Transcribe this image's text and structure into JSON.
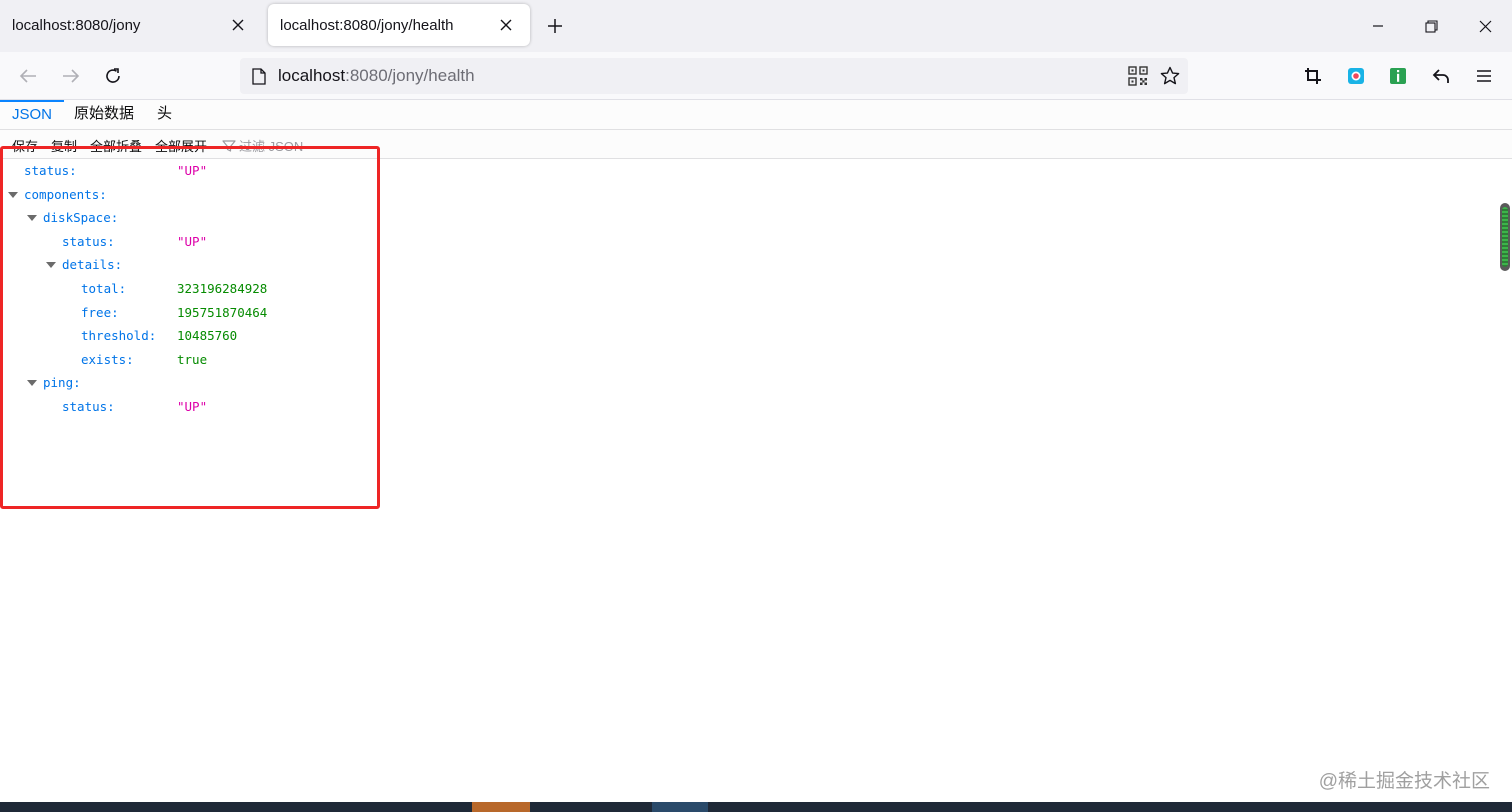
{
  "browser": {
    "tabs": [
      {
        "title": "localhost:8080/jony",
        "active": false
      },
      {
        "title": "localhost:8080/jony/health",
        "active": true
      }
    ],
    "new_tab_glyph": "+",
    "url": {
      "host": "localhost",
      "rest": ":8080/jony/health"
    }
  },
  "viewer": {
    "tabs": [
      "JSON",
      "原始数据",
      "头"
    ],
    "selected_tab": "JSON",
    "toolbar": {
      "save": "保存",
      "copy": "复制",
      "collapse_all": "全部折叠",
      "expand_all": "全部展开",
      "filter_placeholder": "过滤 JSON"
    }
  },
  "json_rows": [
    {
      "key": "status:",
      "value": "\"UP\"",
      "type": "string",
      "depth": 0,
      "expandable": false
    },
    {
      "key": "components:",
      "value": "",
      "type": "object",
      "depth": 0,
      "expandable": true
    },
    {
      "key": "diskSpace:",
      "value": "",
      "type": "object",
      "depth": 1,
      "expandable": true
    },
    {
      "key": "status:",
      "value": "\"UP\"",
      "type": "string",
      "depth": 2,
      "expandable": false
    },
    {
      "key": "details:",
      "value": "",
      "type": "object",
      "depth": 2,
      "expandable": true
    },
    {
      "key": "total:",
      "value": "323196284928",
      "type": "number",
      "depth": 3,
      "expandable": false
    },
    {
      "key": "free:",
      "value": "195751870464",
      "type": "number",
      "depth": 3,
      "expandable": false
    },
    {
      "key": "threshold:",
      "value": "10485760",
      "type": "number",
      "depth": 3,
      "expandable": false
    },
    {
      "key": "exists:",
      "value": "true",
      "type": "boolean",
      "depth": 3,
      "expandable": false
    },
    {
      "key": "ping:",
      "value": "",
      "type": "object",
      "depth": 1,
      "expandable": true
    },
    {
      "key": "status:",
      "value": "\"UP\"",
      "type": "string",
      "depth": 2,
      "expandable": false
    }
  ],
  "watermark": "@稀土掘金技术社区",
  "colors": {
    "key": "#0074e8",
    "string": "#dd00a9",
    "number": "#058b00",
    "highlight_box": "#ee2525",
    "selected_tab": "#0074e8"
  },
  "icons": [
    "close-icon",
    "plus-icon",
    "minimize-icon",
    "restore-icon",
    "window-close-icon",
    "back-arrow-icon",
    "forward-arrow-icon",
    "reload-icon",
    "page-icon",
    "qr-code-icon",
    "star-icon",
    "crop-icon",
    "screenshot-extension-icon",
    "green-extension-icon",
    "undo-icon",
    "menu-icon",
    "filter-icon",
    "twisty-down-icon"
  ]
}
